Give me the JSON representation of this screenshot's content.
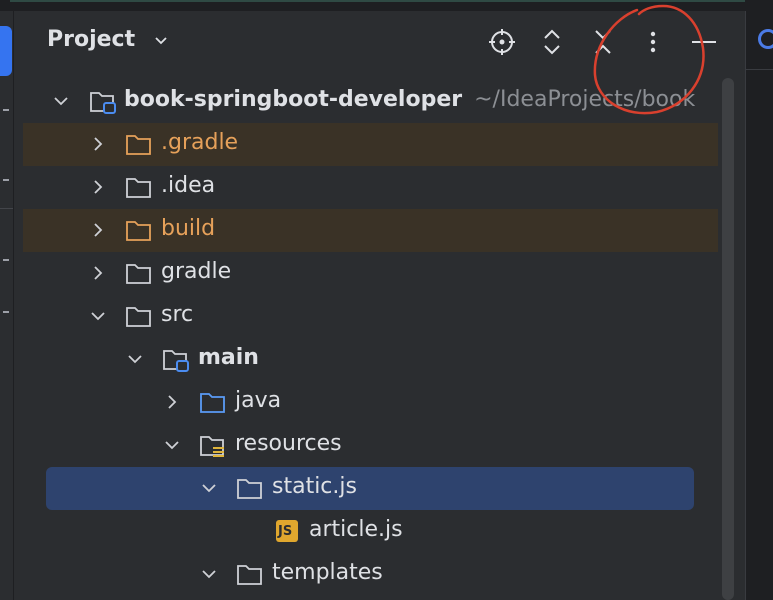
{
  "panel": {
    "title": "Project"
  },
  "toolbar": [
    "locate-icon",
    "expand-all-icon",
    "collapse-all-icon",
    "more-options-icon",
    "hide-icon"
  ],
  "tree": [
    {
      "label": "book-springboot-developer",
      "path": "~/IdeaProjects/book",
      "expanded": true,
      "bold": true,
      "icon": "project-folder"
    },
    {
      "label": ".gradle",
      "expanded": false,
      "excluded": true,
      "icon": "folder"
    },
    {
      "label": ".idea",
      "expanded": false,
      "icon": "folder"
    },
    {
      "label": "build",
      "expanded": false,
      "excluded": true,
      "icon": "folder"
    },
    {
      "label": "gradle",
      "expanded": false,
      "icon": "folder"
    },
    {
      "label": "src",
      "expanded": true,
      "icon": "folder"
    },
    {
      "label": "main",
      "expanded": true,
      "bold": true,
      "icon": "module-folder"
    },
    {
      "label": "java",
      "expanded": false,
      "icon": "source-folder"
    },
    {
      "label": "resources",
      "expanded": true,
      "icon": "resources-folder"
    },
    {
      "label": "static.js",
      "expanded": true,
      "selected": true,
      "icon": "folder"
    },
    {
      "label": "article.js",
      "icon": "js-file",
      "badge": "JS"
    },
    {
      "label": "templates",
      "expanded": true,
      "icon": "folder"
    }
  ],
  "colors": {
    "background": "#2b2d30",
    "selection": "#2e436e",
    "excluded_row": "#3a3226",
    "excluded_text": "#e6a15a",
    "accent": "#3574f0",
    "annotation": "#d9402e"
  }
}
